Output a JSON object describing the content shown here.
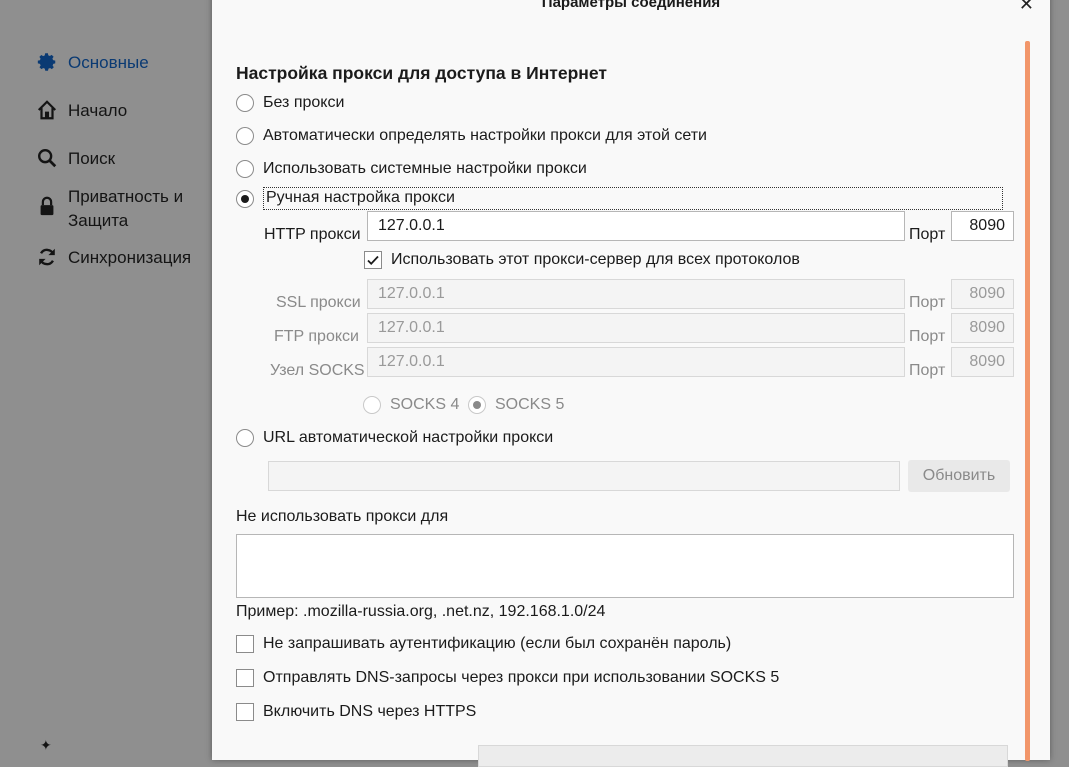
{
  "sidebar": {
    "items": [
      {
        "label": "Основные",
        "icon": "gear-icon",
        "active": true
      },
      {
        "label": "Начало",
        "icon": "home-icon"
      },
      {
        "label": "Поиск",
        "icon": "search-icon"
      },
      {
        "label": "Приватность и Защита",
        "icon": "lock-icon"
      },
      {
        "label": "Синхронизация",
        "icon": "sync-icon"
      }
    ]
  },
  "dialog": {
    "title": "Параметры соединения",
    "heading": "Настройка прокси для доступа в Интернет",
    "proxy_options": {
      "no_proxy": "Без прокси",
      "auto_detect": "Автоматически определять настройки прокси для этой сети",
      "system": "Использовать системные настройки прокси",
      "manual": "Ручная настройка прокси",
      "auto_url": "URL автоматической настройки прокси"
    },
    "selected_option": "manual",
    "http": {
      "label": "HTTP прокси",
      "host": "127.0.0.1",
      "port_label": "Порт",
      "port": "8090"
    },
    "use_for_all": {
      "label": "Использовать этот прокси-сервер для всех протоколов",
      "checked": true
    },
    "ssl": {
      "label": "SSL прокси",
      "host": "127.0.0.1",
      "port_label": "Порт",
      "port": "8090"
    },
    "ftp": {
      "label": "FTP прокси",
      "host": "127.0.0.1",
      "port_label": "Порт",
      "port": "8090"
    },
    "socks": {
      "label": "Узел SOCKS",
      "host": "127.0.0.1",
      "port_label": "Порт",
      "port": "8090"
    },
    "socks_versions": {
      "v4": "SOCKS 4",
      "v5": "SOCKS 5",
      "selected": "v5"
    },
    "auto_url_value": "",
    "reload_button": "Обновить",
    "no_proxy_for": {
      "label": "Не использовать прокси для",
      "value": ""
    },
    "example": "Пример: .mozilla-russia.org, .net.nz, 192.168.1.0/24",
    "checkboxes": [
      {
        "label": "Не запрашивать аутентификацию (если был сохранён пароль)",
        "checked": false
      },
      {
        "label": "Отправлять DNS-запросы через прокси при использовании SOCKS 5",
        "checked": false
      },
      {
        "label": "Включить DNS через HTTPS",
        "checked": false
      }
    ]
  },
  "colors": {
    "accent": "#0a3a73",
    "scrollbar": "#f2966a",
    "overlay": "#8f8f8f",
    "dialog_bg": "#f9f9f9"
  }
}
